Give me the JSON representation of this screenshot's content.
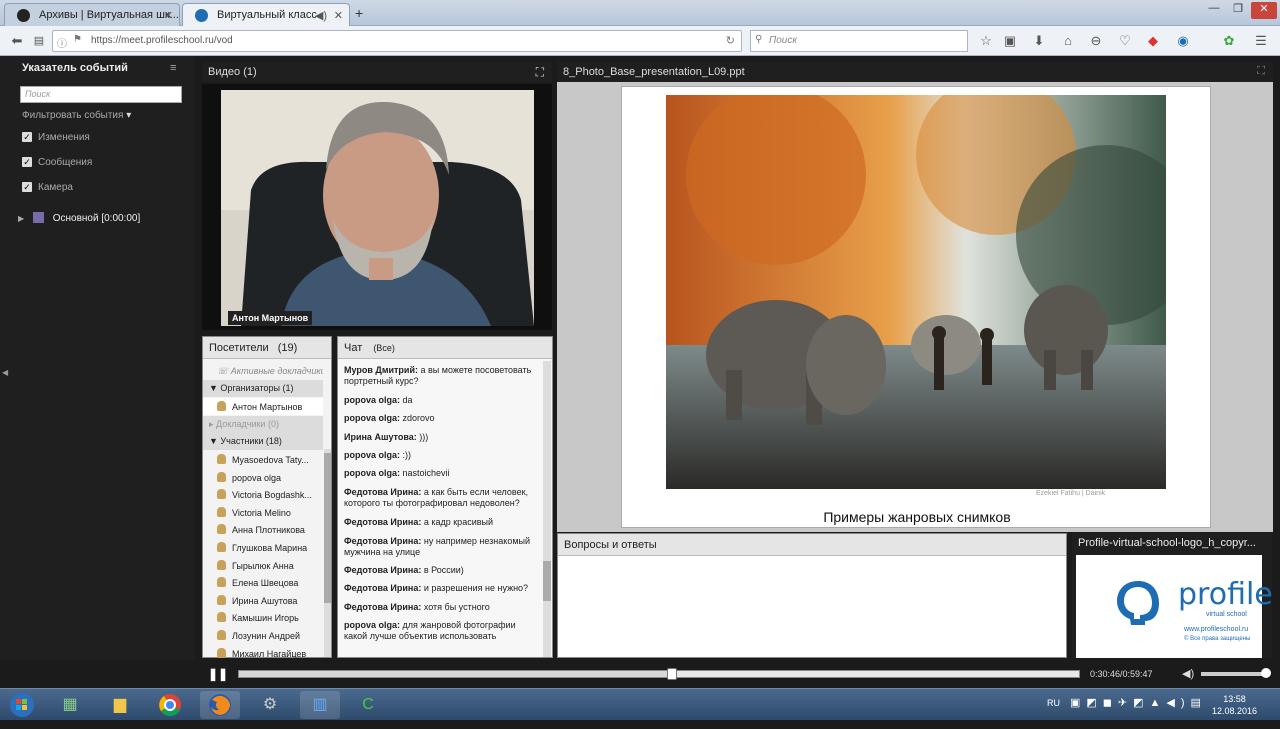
{
  "browser": {
    "tabs": [
      {
        "label": "Архивы | Виртуальная шк...",
        "active": false
      },
      {
        "label": "Виртуальный класс",
        "active": true
      }
    ],
    "url": "https://meet.profileschool.ru/vod",
    "search_placeholder": "Поиск"
  },
  "event_panel": {
    "title": "Указатель событий",
    "search_placeholder": "Поиск",
    "filter_label": "Фильтровать события",
    "filters": [
      {
        "label": "Изменения",
        "checked": true
      },
      {
        "label": "Сообщения",
        "checked": true
      },
      {
        "label": "Камера",
        "checked": true
      }
    ],
    "track_label": "Основной [0:00:00]"
  },
  "video": {
    "title": "Видео",
    "count": "(1)",
    "presenter_name": "Антон Мартынов"
  },
  "visitors": {
    "title": "Посетители",
    "count": "(19)",
    "active_speakers": "Активные докладчики",
    "organizers_group": "Организаторы (1)",
    "organizers": [
      "Антон Мартынов"
    ],
    "speakers_group": "Докладчики (0)",
    "participants_group": "Участники (18)",
    "participants": [
      "Myasoedova Taty...",
      "popova olga",
      "Victoria Bogdashk...",
      "Victoria Melino",
      "Анна Плотникова",
      "Глушкова Марина",
      "Гырылюк Анна",
      "Елена Швецова",
      "Ирина Ашутова",
      "Камышин Игорь",
      "Лозунин Андрей",
      "Михаил Нагайцев"
    ]
  },
  "chat": {
    "title": "Чат",
    "scope": "(Все)",
    "messages": [
      {
        "author": "Муров Дмитрий:",
        "text": "а вы можете посоветовать портретный курс?"
      },
      {
        "author": "popova olga:",
        "text": "da"
      },
      {
        "author": "popova olga:",
        "text": "zdorovo"
      },
      {
        "author": "Ирина Ашутова:",
        "text": ")))"
      },
      {
        "author": "popova olga:",
        "text": ":))"
      },
      {
        "author": "popova olga:",
        "text": "nastoichevii"
      },
      {
        "author": "Федотова Ирина:",
        "text": "а как быть если человек, которого ты фотографировал недоволен?"
      },
      {
        "author": "Федотова Ирина:",
        "text": "а кадр красивый"
      },
      {
        "author": "Федотова Ирина:",
        "text": "ну например незнакомый мужчина на улице"
      },
      {
        "author": "Федотова Ирина:",
        "text": "в России)"
      },
      {
        "author": "Федотова Ирина:",
        "text": "и разрешения не нужно?"
      },
      {
        "author": "Федотова Ирина:",
        "text": "хотя бы устного"
      },
      {
        "author": "popova olga:",
        "text": "для жанровой фотографии какой лучше объектив использовать"
      }
    ]
  },
  "presentation": {
    "title": "8_Photo_Base_presentation_L09.ppt",
    "slide_caption": "Примеры жанровых снимков"
  },
  "qa": {
    "title": "Вопросы и ответы"
  },
  "logo_panel": {
    "title": "Profile-virtual-school-logo_h_copyr...",
    "brand": "profile",
    "sub": "virtual school",
    "url": "www.profileschool.ru",
    "rights": "© Все права защищены"
  },
  "player": {
    "timecode": "0:30:46/0:59:47",
    "progress": 0.515
  },
  "taskbar": {
    "lang": "RU",
    "time": "13:58",
    "date": "12.08.2016"
  }
}
